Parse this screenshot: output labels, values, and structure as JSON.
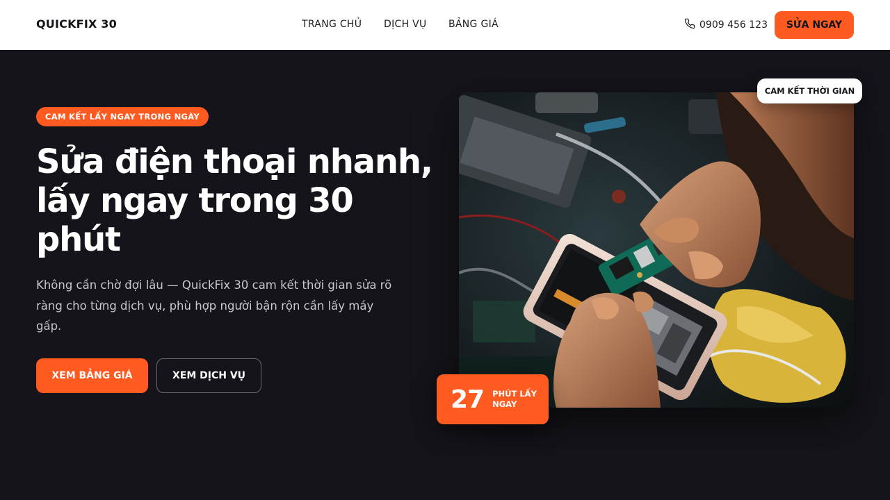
{
  "brand": {
    "logo": "QUICKFIX 30",
    "accent": "#ff5a1f",
    "background": "#14141a"
  },
  "nav": {
    "items": [
      "TRANG CHỦ",
      "DỊCH VỤ",
      "BẢNG GIÁ"
    ]
  },
  "header": {
    "phone_icon": "phone-icon",
    "phone": "0909 456 123",
    "cta": "SỬA NGAY"
  },
  "hero": {
    "badge": "CAM KẾT LẤY NGAY TRONG NGÀY",
    "title_line1": "Sửa điện thoại nhanh,",
    "title_line2": "lấy ngay trong 30",
    "title_line3": "phút",
    "description": "Không cần chờ đợi lâu — QuickFix 30 cam kết thời gian sửa rõ ràng cho từng dịch vụ, phù hợp người bận rộn cần lấy máy gấp.",
    "primary_button": "XEM BẢNG GIÁ",
    "secondary_button": "XEM DỊCH VỤ"
  },
  "media": {
    "tag": "CAM KẾT THỜI GIAN",
    "stat_value": "27",
    "stat_label": "PHÚT LẤY NGAY"
  }
}
